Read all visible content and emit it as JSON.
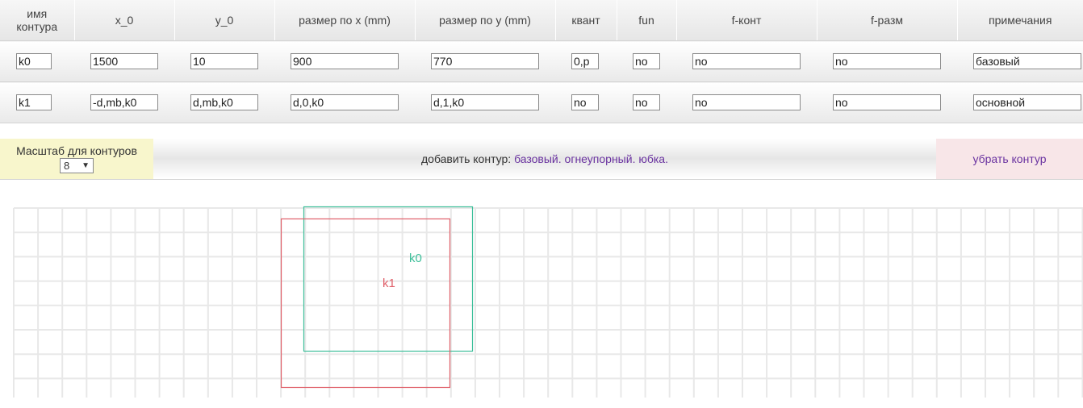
{
  "table": {
    "headers": [
      {
        "line1": "имя",
        "line2": "контура"
      },
      {
        "line1": "x_0",
        "line2": ""
      },
      {
        "line1": "y_0",
        "line2": ""
      },
      {
        "line1": "размер по x (mm)",
        "line2": ""
      },
      {
        "line1": "размер по y (mm)",
        "line2": ""
      },
      {
        "line1": "квант",
        "line2": ""
      },
      {
        "line1": "fun",
        "line2": ""
      },
      {
        "line1": "f-конт",
        "line2": ""
      },
      {
        "line1": "f-разм",
        "line2": ""
      },
      {
        "line1": "примечания",
        "line2": ""
      }
    ],
    "rows": [
      {
        "name": "k0",
        "x0": "1500",
        "y0": "10",
        "sx": "900",
        "sy": "770",
        "kvant": "0,p",
        "fun": "no",
        "fkont": "no",
        "frazm": "no",
        "note": "базовый"
      },
      {
        "name": "k1",
        "x0": "-d,mb,k0",
        "y0": "d,mb,k0",
        "sx": "d,0,k0",
        "sy": "d,1,k0",
        "kvant": "no",
        "fun": "no",
        "fkont": "no",
        "frazm": "no",
        "note": "основной"
      }
    ]
  },
  "toolbar": {
    "scale_label": "Масштаб для контуров",
    "scale_value": "8",
    "add_label": "добавить контур:",
    "add_options": [
      "базовый.",
      "огнеупорный.",
      "юбка."
    ],
    "remove_label": "убрать контур"
  },
  "canvas": {
    "contours": [
      {
        "label": "k0",
        "color": "#3dbf9a"
      },
      {
        "label": "k1",
        "color": "#e0606a"
      }
    ]
  },
  "colors": {
    "link": "#6a33a0",
    "scale_bg": "#f8f6cc",
    "remove_bg": "#f8e6e8",
    "grid": "#e8e8e8"
  }
}
